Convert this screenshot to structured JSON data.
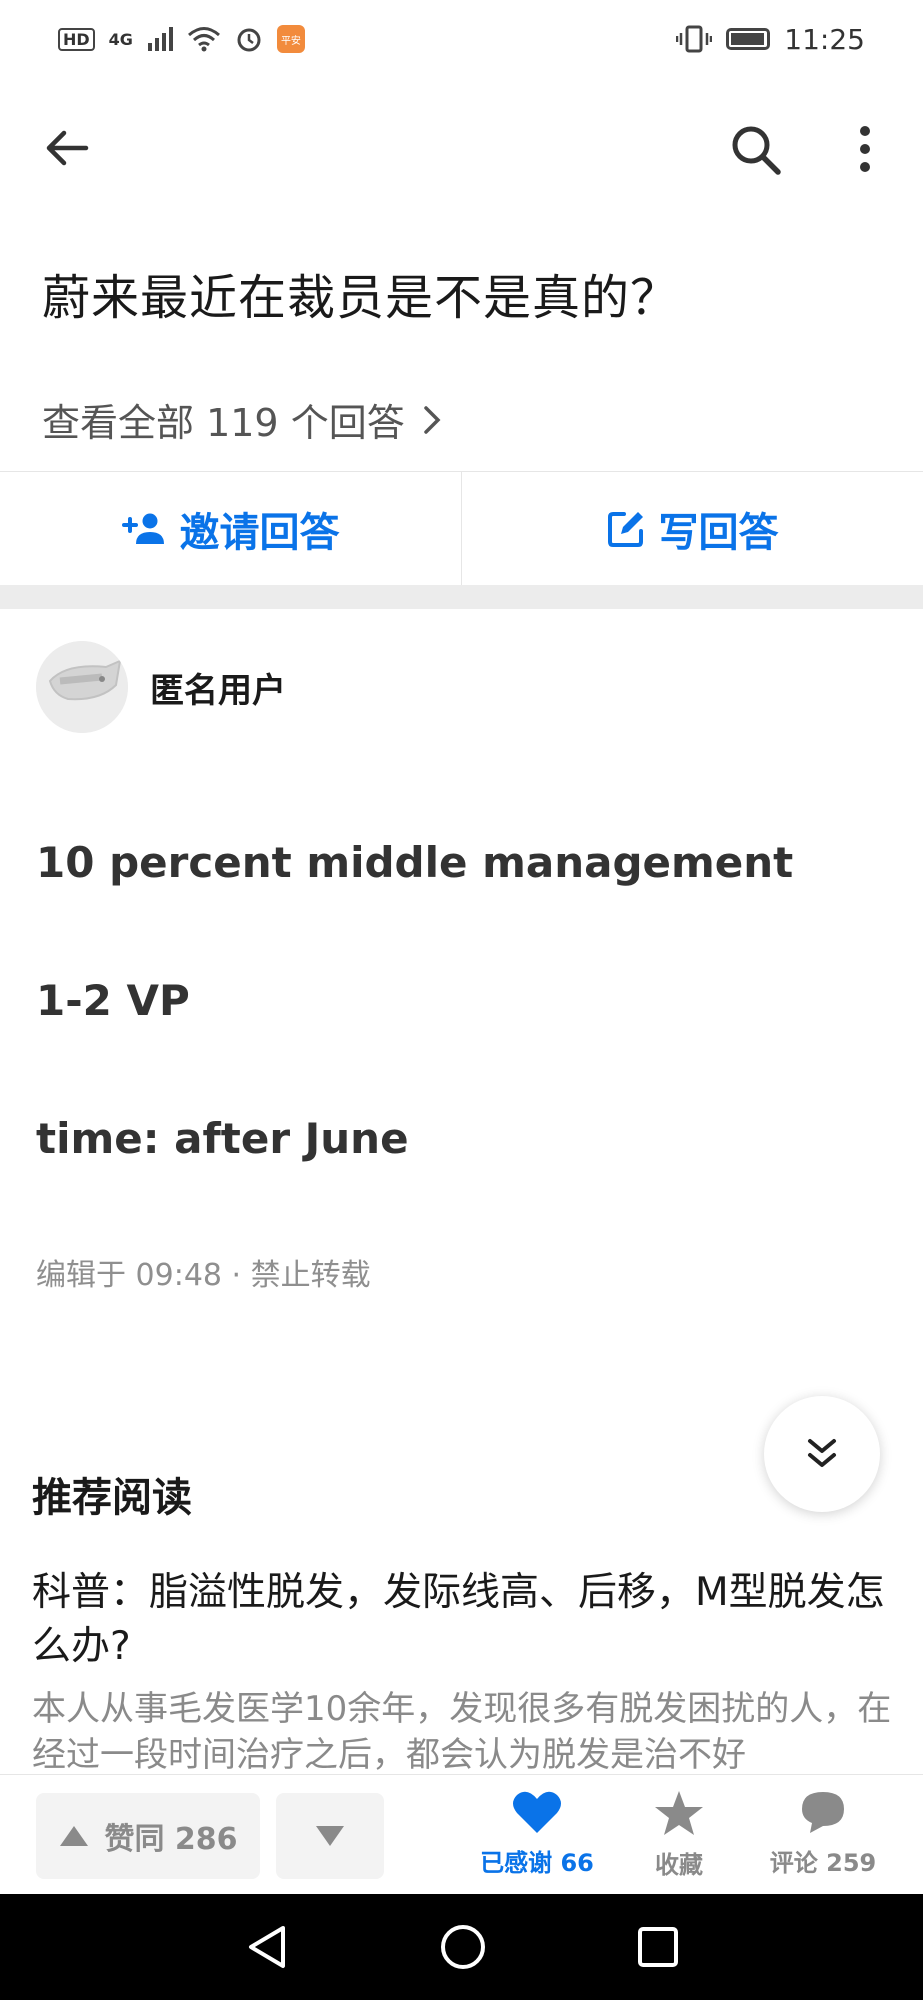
{
  "status_bar": {
    "network": "4G",
    "app_badge": "平安银行",
    "time": "11:25"
  },
  "question": {
    "title": "蔚来最近在裁员是不是真的？",
    "view_all": "查看全部 119 个回答"
  },
  "actions": {
    "invite": "邀请回答",
    "write": "写回答"
  },
  "answer": {
    "author": "匿名用户",
    "paragraphs": [
      "10 percent middle management",
      "1-2 VP",
      "time: after June"
    ],
    "meta": "编辑于 09:48 · 禁止转载"
  },
  "recommended": {
    "heading": "推荐阅读",
    "title": "科普：脂溢性脱发，发际线高、后移，M型脱发怎么办?",
    "excerpt": "本人从事毛发医学10余年，发现很多有脱发困扰的人，在经过一段时间治疗之后，都会认为脱发是治不好"
  },
  "bottom_bar": {
    "agree": "赞同 286",
    "thanked": "已感谢 66",
    "collect": "收藏",
    "comments": "评论 259"
  },
  "colors": {
    "accent": "#0a73e8",
    "muted": "#8a8a8a",
    "divider_band": "#ececec"
  }
}
